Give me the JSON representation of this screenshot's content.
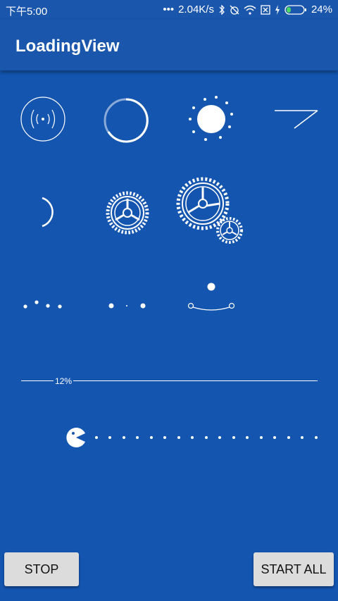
{
  "status": {
    "time": "下午5:00",
    "speed": "2.04K/s",
    "battery": "24%",
    "icons": [
      "more-dots-icon",
      "bluetooth-icon",
      "alarm-off-icon",
      "wifi-icon",
      "sim-off-icon",
      "charging-icon",
      "battery-icon"
    ]
  },
  "app": {
    "title": "LoadingView"
  },
  "progress": {
    "label": "12%",
    "value": 0.12
  },
  "buttons": {
    "stop": "STOP",
    "start_all": "START ALL"
  },
  "colors": {
    "background": "#1455b0",
    "bar": "#1a56ac",
    "foreground": "#ffffff",
    "button": "#dcdcdc"
  }
}
